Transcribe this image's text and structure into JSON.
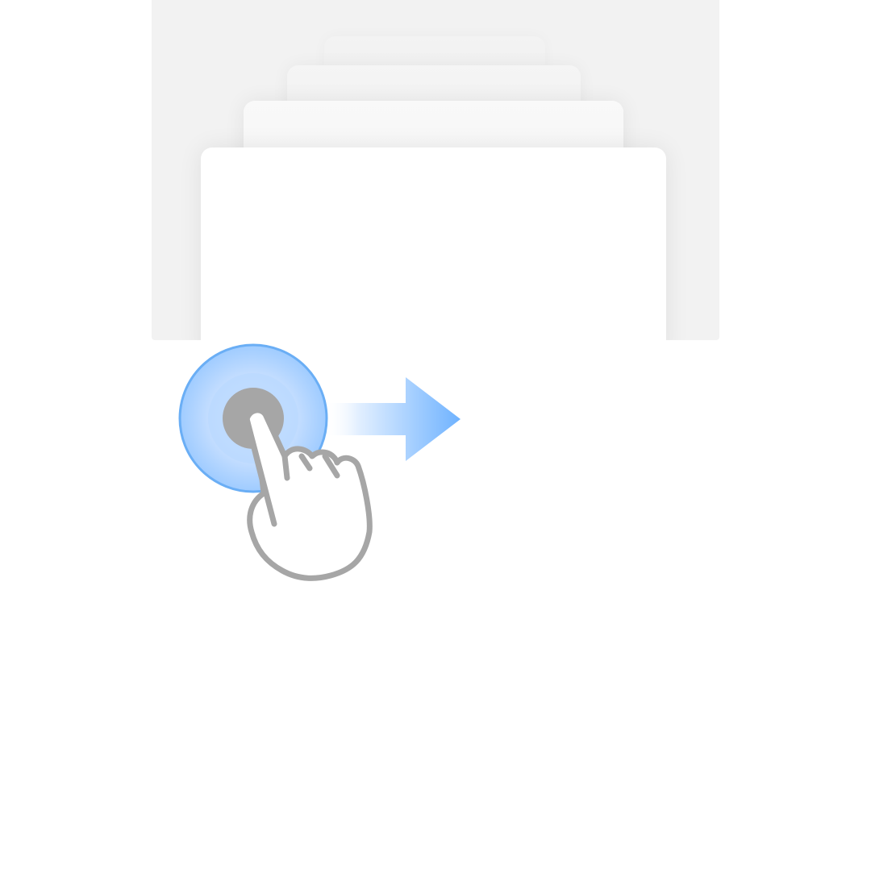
{
  "screen": {
    "background": "#ffffff",
    "panel_color": "#f2f2f2"
  },
  "card_stack": {
    "card_count": 4,
    "front_card_color": "#ffffff"
  },
  "gesture_hint": {
    "gesture": "swipe-right",
    "touch_color": "#6aaef5",
    "arrow_color": "#6eb2ff",
    "hand_stroke_color": "#a6a6a6",
    "icons": [
      "touch-point-icon",
      "swipe-right-arrow-icon",
      "hand-pointer-icon"
    ]
  }
}
